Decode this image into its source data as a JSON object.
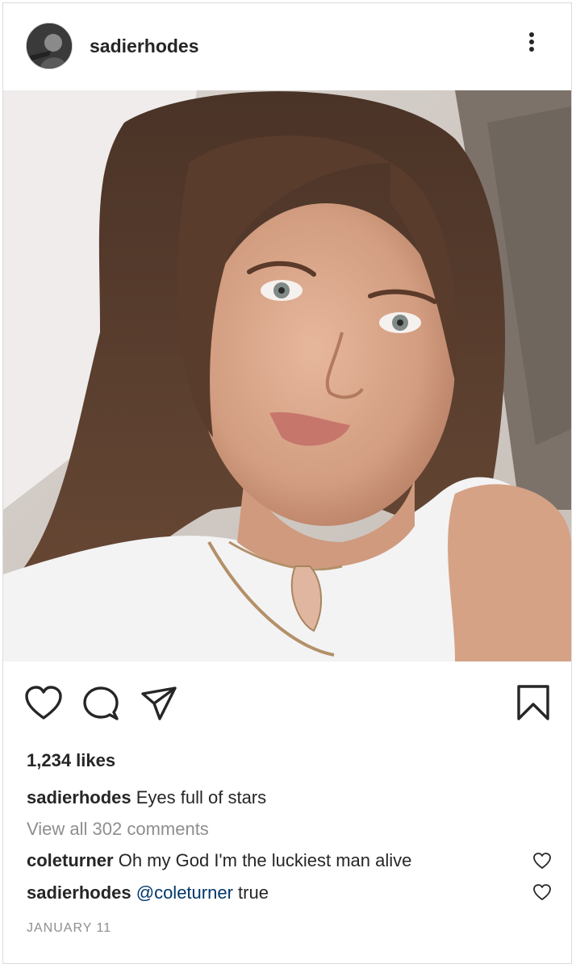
{
  "post": {
    "username": "sadierhodes",
    "likes": "1,234 likes",
    "caption": {
      "user": "sadierhodes",
      "text": "Eyes full of stars"
    },
    "view_all": "View all 302 comments",
    "comments": [
      {
        "user": "coleturner",
        "text": "Oh my God I'm the luckiest man alive"
      },
      {
        "user": "sadierhodes",
        "mention": "@coleturner",
        "text": "true"
      }
    ],
    "date": "JANUARY 11"
  },
  "icons": {
    "more": "more-options-icon",
    "like": "heart-icon",
    "comment": "comment-bubble-icon",
    "share": "paper-plane-icon",
    "save": "bookmark-icon"
  },
  "colors": {
    "text": "#262626",
    "muted": "#8e8e8e",
    "mention": "#00376b",
    "border": "#dbdbdb"
  }
}
